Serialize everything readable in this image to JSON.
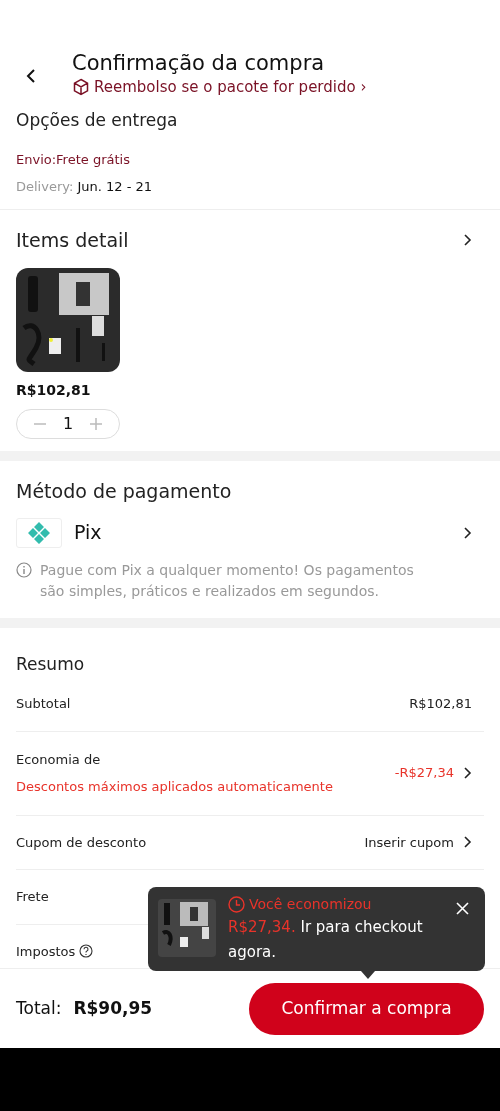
{
  "header": {
    "title": "Confirmação da compra",
    "guarantee": "Reembolso se o pacote for perdido ›"
  },
  "delivery": {
    "title": "Opções de entrega",
    "shipping": "Envio:Frete grátis",
    "delivery_label": "Delivery:",
    "delivery_dates": "Jun. 12 - 21"
  },
  "items": {
    "title": "Items detail",
    "products": [
      {
        "kind": "picture",
        "price": "R$102,81",
        "quantity": "1"
      }
    ]
  },
  "payment": {
    "title": "Método de pagamento",
    "method": "Pix",
    "note": "Pague com Pix a qualquer momento! Os pagamentos são simples, práticos e realizados em segundos."
  },
  "summary": {
    "title": "Resumo",
    "rows": [
      {
        "kind": "plain",
        "label": "Subtotal",
        "value": "R$102,81",
        "arrow": false
      },
      {
        "kind": "discount",
        "label": "Economia de",
        "sublabel": "Descontos máximos aplicados automaticamente",
        "value": "-R$27,34",
        "arrow": true
      },
      {
        "kind": "plain",
        "label": "Cupom de desconto",
        "value": "Inserir cupom",
        "arrow": true
      },
      {
        "kind": "shipping",
        "label": "Frete",
        "arrow": false
      },
      {
        "kind": "help",
        "label": "Impostos",
        "arrow": false
      }
    ]
  },
  "popup": {
    "headline": "Você economizou",
    "amount": "R$27,34.",
    "message": "Ir para checkout agora."
  },
  "footer": {
    "total_label": "Total:",
    "total": "R$90,95",
    "button": "Confirmar a compra"
  }
}
